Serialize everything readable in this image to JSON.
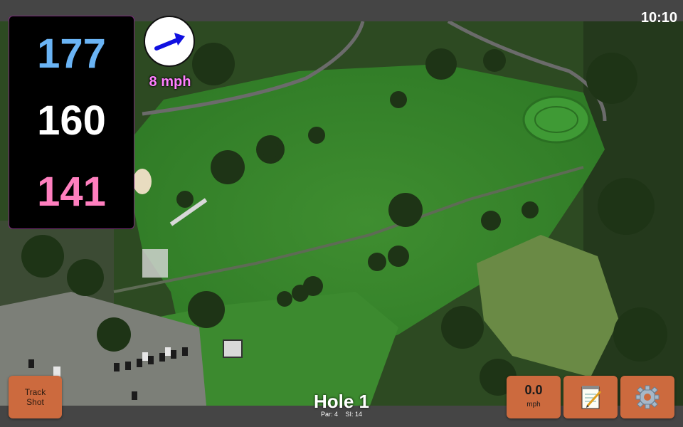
{
  "status_bar": {
    "time": "10:10"
  },
  "distances": {
    "back": "177",
    "middle": "160",
    "front": "141"
  },
  "wind": {
    "speed": "8 mph",
    "direction_icon": "arrow-up-right-icon"
  },
  "hole": {
    "title": "Hole 1",
    "par": "Par: 4",
    "stroke_index": "SI: 14"
  },
  "buttons": {
    "track_shot_line1": "Track",
    "track_shot_line2": "Shot",
    "speed_value": "0.0",
    "speed_unit": "mph",
    "notes_icon": "notepad-icon",
    "settings_icon": "gear-icon"
  },
  "colors": {
    "back_distance": "#6ab4f5",
    "middle_distance": "#ffffff",
    "front_distance": "#ff7fbf",
    "button_orange": "#cc6a3e",
    "wind_text": "#ff80ff"
  }
}
